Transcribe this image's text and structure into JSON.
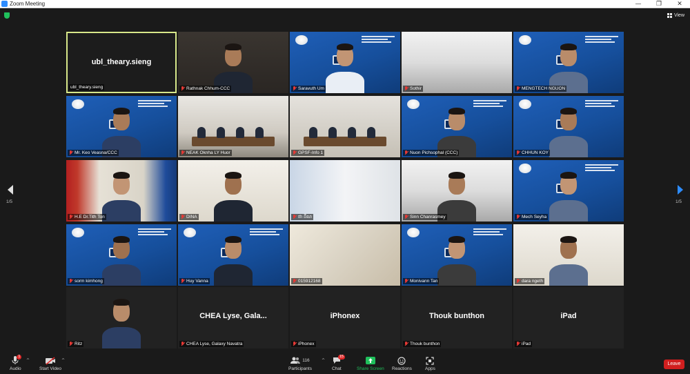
{
  "window": {
    "title": "Zoom Meeting",
    "minimize": "—",
    "restore": "❐",
    "close": "✕"
  },
  "topbar": {
    "view_label": "View"
  },
  "pagination": {
    "left_indicator": "1/5",
    "right_indicator": "1/5"
  },
  "tiles": [
    {
      "name": "ubl_theary.sieng",
      "center": "ubl_theary.sieng",
      "active": true,
      "muted": false,
      "style": "blank"
    },
    {
      "name": "Rathnak Chhum-CCC",
      "muted": true,
      "style": "photo-dark"
    },
    {
      "name": "Saravuth Um",
      "muted": true,
      "style": "blue"
    },
    {
      "name": "Sothir",
      "muted": true,
      "style": "ceiling"
    },
    {
      "name": "MENGTECH NGUON",
      "muted": true,
      "style": "blue"
    },
    {
      "name": "Mr. Keo Veasna/CCC",
      "muted": true,
      "style": "blue"
    },
    {
      "name": "NEAK Oknha LY Huor",
      "muted": true,
      "style": "room"
    },
    {
      "name": "GPSF-Info 1",
      "muted": true,
      "style": "room2"
    },
    {
      "name": "Nuon Pichsophal (CCC)",
      "muted": true,
      "style": "blue"
    },
    {
      "name": "CHHUN KOY",
      "muted": true,
      "style": "blue"
    },
    {
      "name": "H.E Dr.Tith Ton",
      "muted": true,
      "style": "flag"
    },
    {
      "name": "DINA",
      "muted": true,
      "style": "wall"
    },
    {
      "name": "ផា ដឹណ",
      "muted": true,
      "style": "blind"
    },
    {
      "name": "Sinn Chanrasmey",
      "muted": true,
      "style": "ceiling"
    },
    {
      "name": "Mech Seyha",
      "muted": true,
      "style": "blue"
    },
    {
      "name": "sorm kimhong",
      "muted": true,
      "style": "blue"
    },
    {
      "name": "Huy Vanna",
      "muted": true,
      "style": "blue"
    },
    {
      "name": "015912168",
      "muted": true,
      "style": "marble"
    },
    {
      "name": "Monivann Tan",
      "muted": true,
      "style": "blue"
    },
    {
      "name": "dara ngeth",
      "muted": true,
      "style": "wall"
    },
    {
      "name": "Ritz",
      "muted": true,
      "style": "photo-blank"
    },
    {
      "name": "CHEA Lyse, Galaxy Navatra",
      "center": "CHEA Lyse, Gala...",
      "muted": true,
      "style": "blank"
    },
    {
      "name": "iPhonex",
      "center": "iPhonex",
      "muted": true,
      "style": "blank"
    },
    {
      "name": "Thouk bunthon",
      "center": "Thouk bunthon",
      "muted": true,
      "style": "blank"
    },
    {
      "name": "iPad",
      "center": "iPad",
      "muted": true,
      "style": "blank"
    }
  ],
  "toolbar": {
    "audio_label": "Audio",
    "video_label": "Start Video",
    "participants_label": "Participants",
    "participants_count": "116",
    "chat_label": "Chat",
    "chat_badge": "15",
    "share_label": "Share Screen",
    "reactions_label": "Reactions",
    "apps_label": "Apps",
    "leave_label": "Leave",
    "audio_badge": "1",
    "share_color": "#20c05c"
  }
}
